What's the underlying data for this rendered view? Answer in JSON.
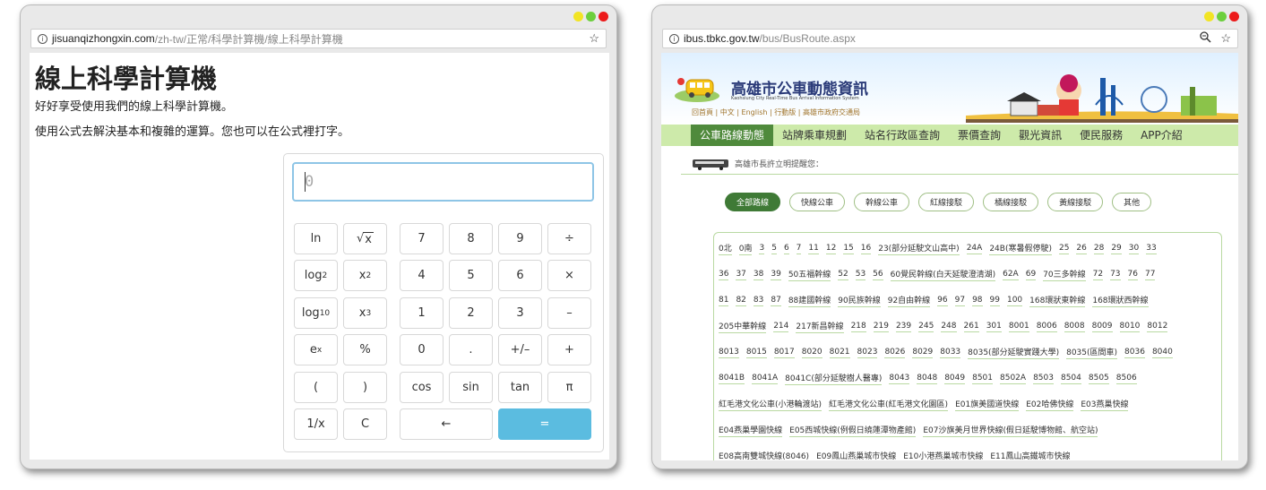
{
  "left_window": {
    "url_host": "jisuanqizhongxin.com",
    "url_path": "/zh-tw/正常/科學計算機/線上科學計算機",
    "heading": "線上科學計算機",
    "intro": "好好享受使用我們的線上科學計算機。",
    "desc": "使用公式去解決基本和複雜的運算。您也可以在公式裡打字。",
    "input_value": "0",
    "keys": {
      "ln": "ln",
      "sqrt": "x",
      "k7": "7",
      "k8": "8",
      "k9": "9",
      "div": "÷",
      "log2_base": "log",
      "log2_sub": "2",
      "sq_base": "x",
      "sq_sup": "2",
      "k4": "4",
      "k5": "5",
      "k6": "6",
      "mul": "×",
      "log10_base": "log",
      "log10_sub": "10",
      "cube_base": "x",
      "cube_sup": "3",
      "k1": "1",
      "k2": "2",
      "k3": "3",
      "sub": "–",
      "exp_base": "e",
      "exp_sup": "x",
      "pct": "%",
      "k0": "0",
      "dot": ".",
      "neg": "+/–",
      "add": "+",
      "lpar": "(",
      "rpar": ")",
      "cos": "cos",
      "sin": "sin",
      "tan": "tan",
      "pi": "π",
      "inv": "1/x",
      "clear": "C",
      "back": "←",
      "eq": "="
    }
  },
  "right_window": {
    "url_host": "ibus.tbkc.gov.tw",
    "url_path": "/bus/BusRoute.aspx",
    "site_title": "高雄市公車動態資訊",
    "site_subtitle": "Kaohsiung City Real-Time Bus Arrival Information System",
    "site_links": "回首頁 | 中文 | English | 行動版 | 高雄市政府交通局",
    "nav": [
      "公車路線動態",
      "站牌乘車規劃",
      "站名行政區查詢",
      "票價查詢",
      "觀光資訊",
      "便民服務",
      "APP介紹"
    ],
    "notice": "高雄市長許立明提醒您：",
    "filters": [
      "全部路線",
      "快線公車",
      "幹線公車",
      "紅線接駁",
      "橘線接駁",
      "黃線接駁",
      "其他"
    ],
    "route_lines": [
      [
        "0北",
        "0南",
        "3",
        "5",
        "6",
        "7",
        "11",
        "12",
        "15",
        "16",
        "23(部分延駛文山高中)",
        "24A",
        "24B(寒暑假停駛)",
        "25",
        "26",
        "28",
        "29",
        "30",
        "33"
      ],
      [
        "36",
        "37",
        "38",
        "39",
        "50五福幹線",
        "52",
        "53",
        "56",
        "60覺民幹線(白天延駛澄清湖)",
        "62A",
        "69",
        "70三多幹線",
        "72",
        "73",
        "76",
        "77"
      ],
      [
        "81",
        "82",
        "83",
        "87",
        "88建國幹線",
        "90民族幹線",
        "92自由幹線",
        "96",
        "97",
        "98",
        "99",
        "100",
        "168環狀東幹線",
        "168環狀西幹線"
      ],
      [
        "205中華幹線",
        "214",
        "217新昌幹線",
        "218",
        "219",
        "239",
        "245",
        "248",
        "261",
        "301",
        "8001",
        "8006",
        "8008",
        "8009",
        "8010",
        "8012"
      ],
      [
        "8013",
        "8015",
        "8017",
        "8020",
        "8021",
        "8023",
        "8026",
        "8029",
        "8033",
        "8035(部分延駛實踐大學)",
        "8035(區間車)",
        "8036",
        "8040"
      ],
      [
        "8041B",
        "8041A",
        "8041C(部分延駛樹人醫專)",
        "8043",
        "8048",
        "8049",
        "8501",
        "8502A",
        "8503",
        "8504",
        "8505",
        "8506"
      ],
      [
        "紅毛港文化公車(小港輪渡站)",
        "紅毛港文化公車(紅毛港文化園區)",
        "E01旗美國道快線",
        "E02哈佛快線",
        "E03燕巢快線"
      ],
      [
        "E04燕巢學園快線",
        "E05西城快線(例假日繞蓮潭物產館)",
        "E07沙旗美月世界快線(假日延駛博物館、航空站)"
      ],
      [
        "E08高南雙城快線(8046)",
        "E09鳳山燕巢城市快線",
        "E10小港燕巢城市快線",
        "E11鳳山高鐵城市快線"
      ]
    ]
  }
}
